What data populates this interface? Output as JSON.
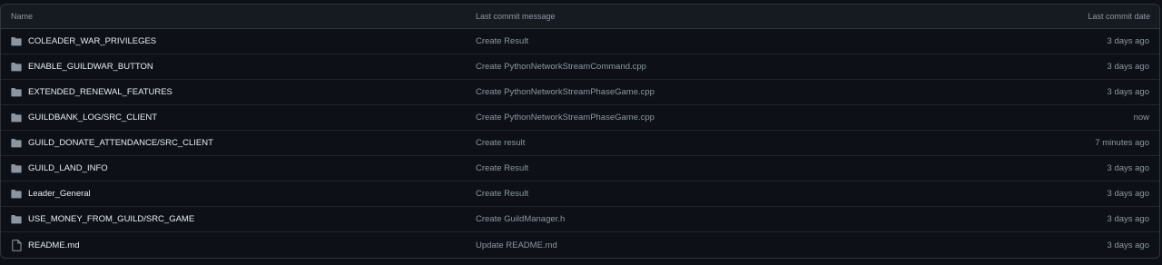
{
  "table": {
    "headers": {
      "name": "Name",
      "message": "Last commit message",
      "date": "Last commit date"
    },
    "rows": [
      {
        "type": "folder",
        "name": "COLEADER_WAR_PRIVILEGES",
        "message": "Create Result",
        "date": "3 days ago"
      },
      {
        "type": "folder",
        "name": "ENABLE_GUILDWAR_BUTTON",
        "message": "Create PythonNetworkStreamCommand.cpp",
        "date": "3 days ago"
      },
      {
        "type": "folder",
        "name": "EXTENDED_RENEWAL_FEATURES",
        "message": "Create PythonNetworkStreamPhaseGame.cpp",
        "date": "3 days ago"
      },
      {
        "type": "folder",
        "name": "GUILDBANK_LOG/SRC_CLIENT",
        "message": "Create PythonNetworkStreamPhaseGame.cpp",
        "date": "now"
      },
      {
        "type": "folder",
        "name": "GUILD_DONATE_ATTENDANCE/SRC_CLIENT",
        "message": "Create result",
        "date": "7 minutes ago"
      },
      {
        "type": "folder",
        "name": "GUILD_LAND_INFO",
        "message": "Create Result",
        "date": "3 days ago"
      },
      {
        "type": "folder",
        "name": "Leader_General",
        "message": "Create Result",
        "date": "3 days ago"
      },
      {
        "type": "folder",
        "name": "USE_MONEY_FROM_GUILD/SRC_GAME",
        "message": "Create GuildManager.h",
        "date": "3 days ago"
      },
      {
        "type": "file",
        "name": "README.md",
        "message": "Update README.md",
        "date": "3 days ago"
      }
    ]
  },
  "colors": {
    "background": "#0d1117",
    "header_bg": "#161b22",
    "border": "#30363d",
    "folder_icon": "#8d96a0",
    "text_primary": "#e6edf3",
    "text_muted": "#8d96a0"
  },
  "icons": {
    "folder": "folder-icon",
    "file": "file-icon"
  }
}
